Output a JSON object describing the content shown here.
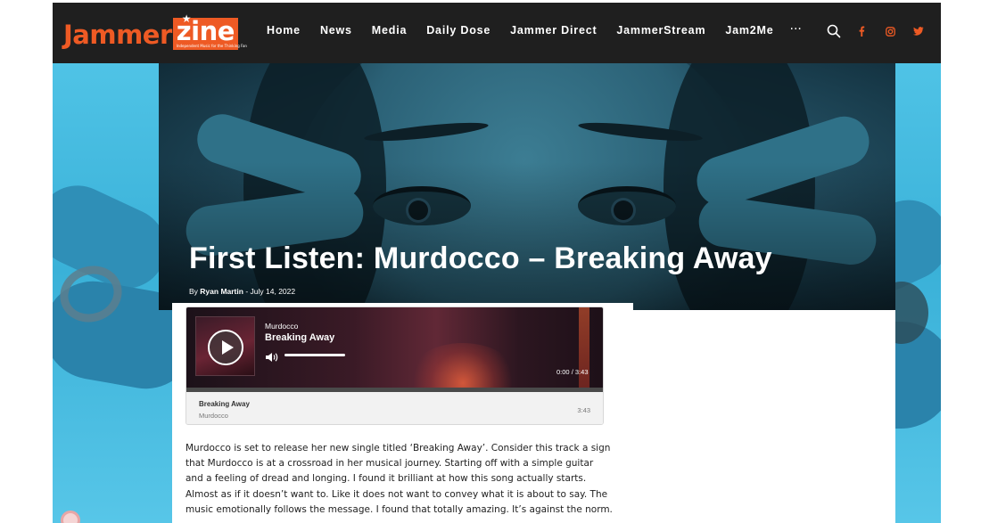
{
  "header": {
    "logo": {
      "part1": "Jammer",
      "part2": "zine",
      "tagline": "Independent Music for the Thinking Fan"
    },
    "nav": [
      "Home",
      "News",
      "Media",
      "Daily Dose",
      "Jammer Direct",
      "JammerStream",
      "Jam2Me"
    ],
    "more": "···",
    "icons": [
      "search-icon",
      "facebook-icon",
      "instagram-icon",
      "twitter-icon"
    ],
    "accent_color": "#ee5a24"
  },
  "post": {
    "title": "First Listen: Murdocco – Breaking Away",
    "by": "By",
    "author": "Ryan Martin",
    "separator": "-",
    "date": "July 14, 2022"
  },
  "player": {
    "artist": "Murdocco",
    "title": "Breaking Away",
    "current_time": "0:00",
    "time_separator": "/",
    "duration": "3:43",
    "progress": 0,
    "playlist": [
      {
        "title": "Breaking Away",
        "artist": "Murdocco",
        "duration": "3:43"
      }
    ]
  },
  "article": {
    "paragraph": "Murdocco is set to release her new single titled ‘Breaking Away’. Consider this track a sign that Murdocco is at a crossroad in her musical journey. Starting off with a simple guitar and a feeling of dread and longing. I found it brilliant at how this song actually starts. Almost as if it doesn’t want to. Like it does not want to convey what it is about to say. The music emotionally follows the message. I found that totally amazing. It’s against the norm."
  }
}
